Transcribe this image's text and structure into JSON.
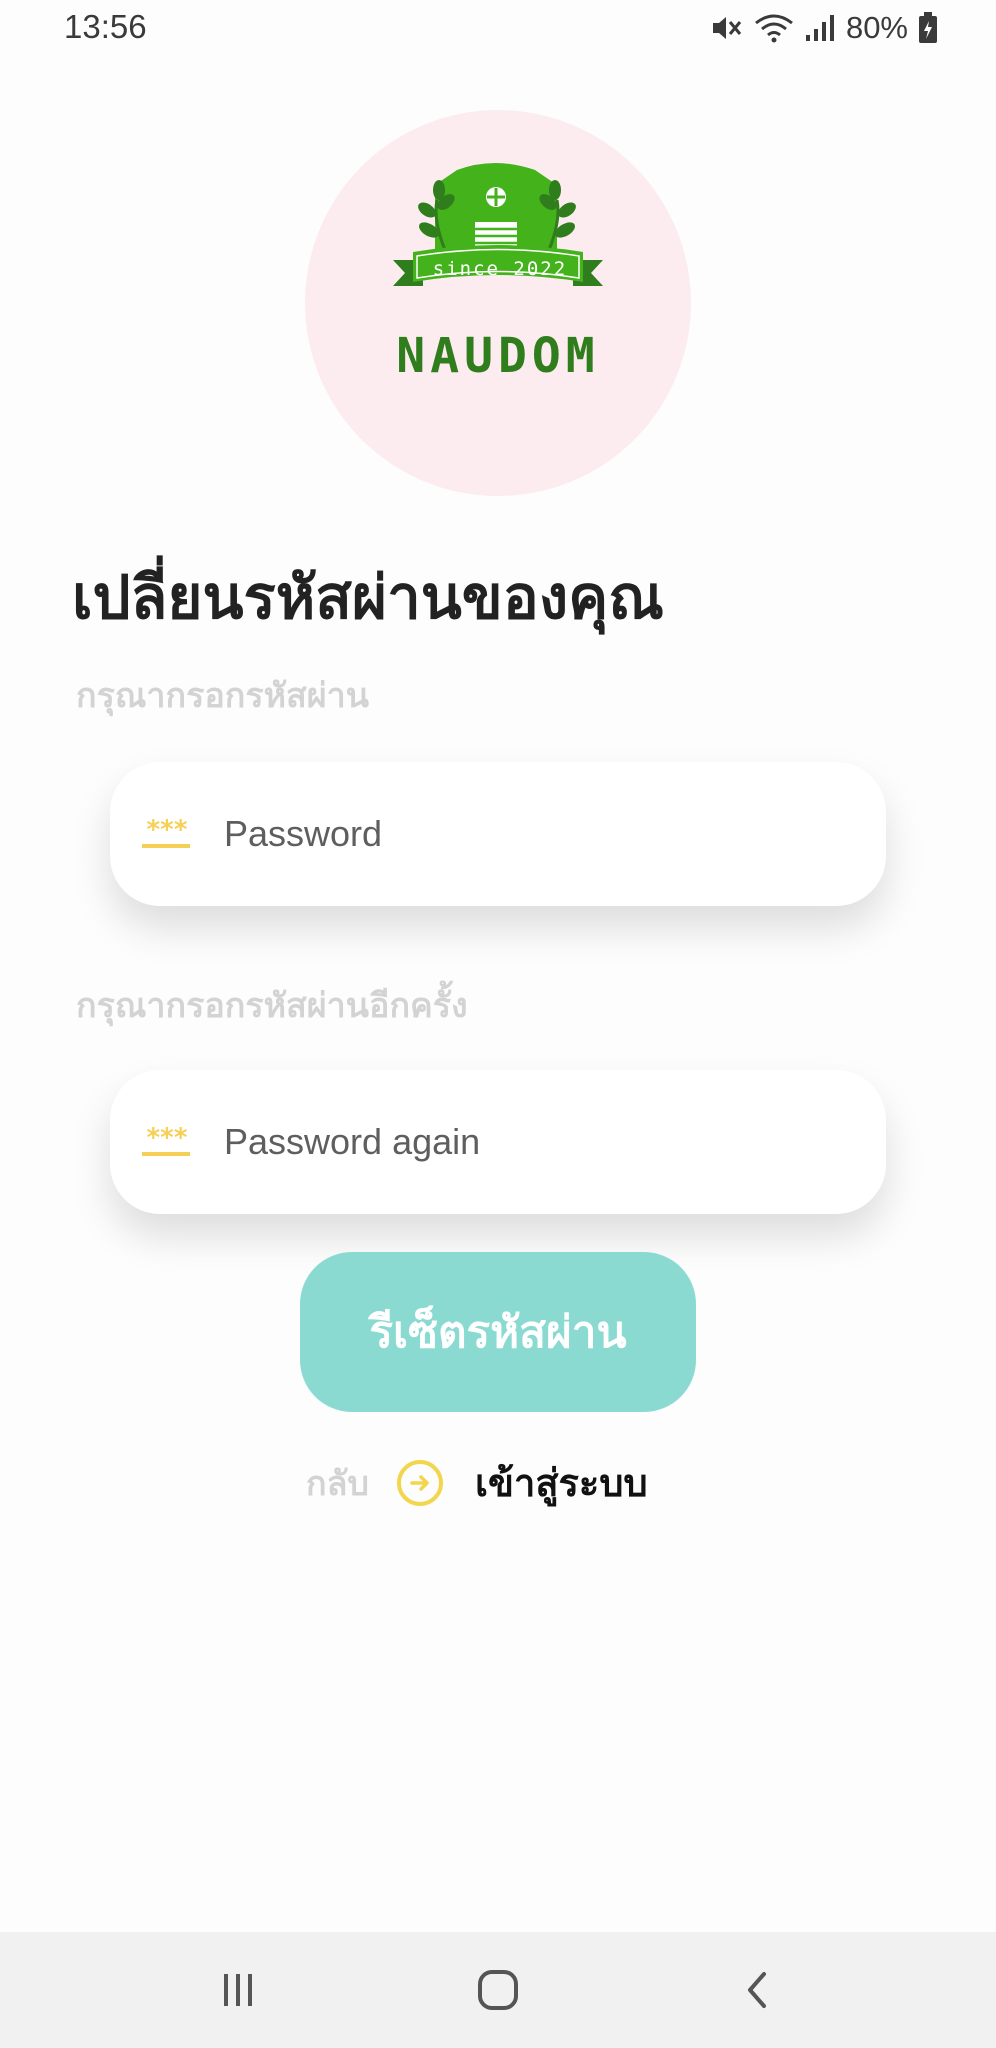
{
  "status_bar": {
    "time": "13:56",
    "battery": "80%",
    "icons": [
      "mute-icon",
      "wifi-icon",
      "signal-icon",
      "battery-charging-icon"
    ]
  },
  "logo": {
    "since_text": "since 2022",
    "brand_name": "NAUDOM",
    "background_color": "#fcecef",
    "brand_color": "#2f7d1c",
    "accent_green": "#43b21b",
    "icon": "barn-logo"
  },
  "page": {
    "title": "เปลี่ยนรหัสผ่านของคุณ"
  },
  "form": {
    "password_label": "กรุณากรอกรหัสผ่าน",
    "password_placeholder": "Password",
    "confirm_label": "กรุณากรอกรหัสผ่านอีกครั้ง",
    "confirm_placeholder": "Password again",
    "input_icon": "***",
    "input_icon_color": "#f6cf55"
  },
  "actions": {
    "reset_button_label": "รีเซ็ตรหัสผ่าน",
    "reset_button_color": "#8adad2",
    "back_label": "กลับ",
    "login_link_label": "เข้าสู่ระบบ"
  },
  "nav_bar": {
    "buttons": [
      "recents-icon",
      "home-icon",
      "back-icon"
    ]
  }
}
